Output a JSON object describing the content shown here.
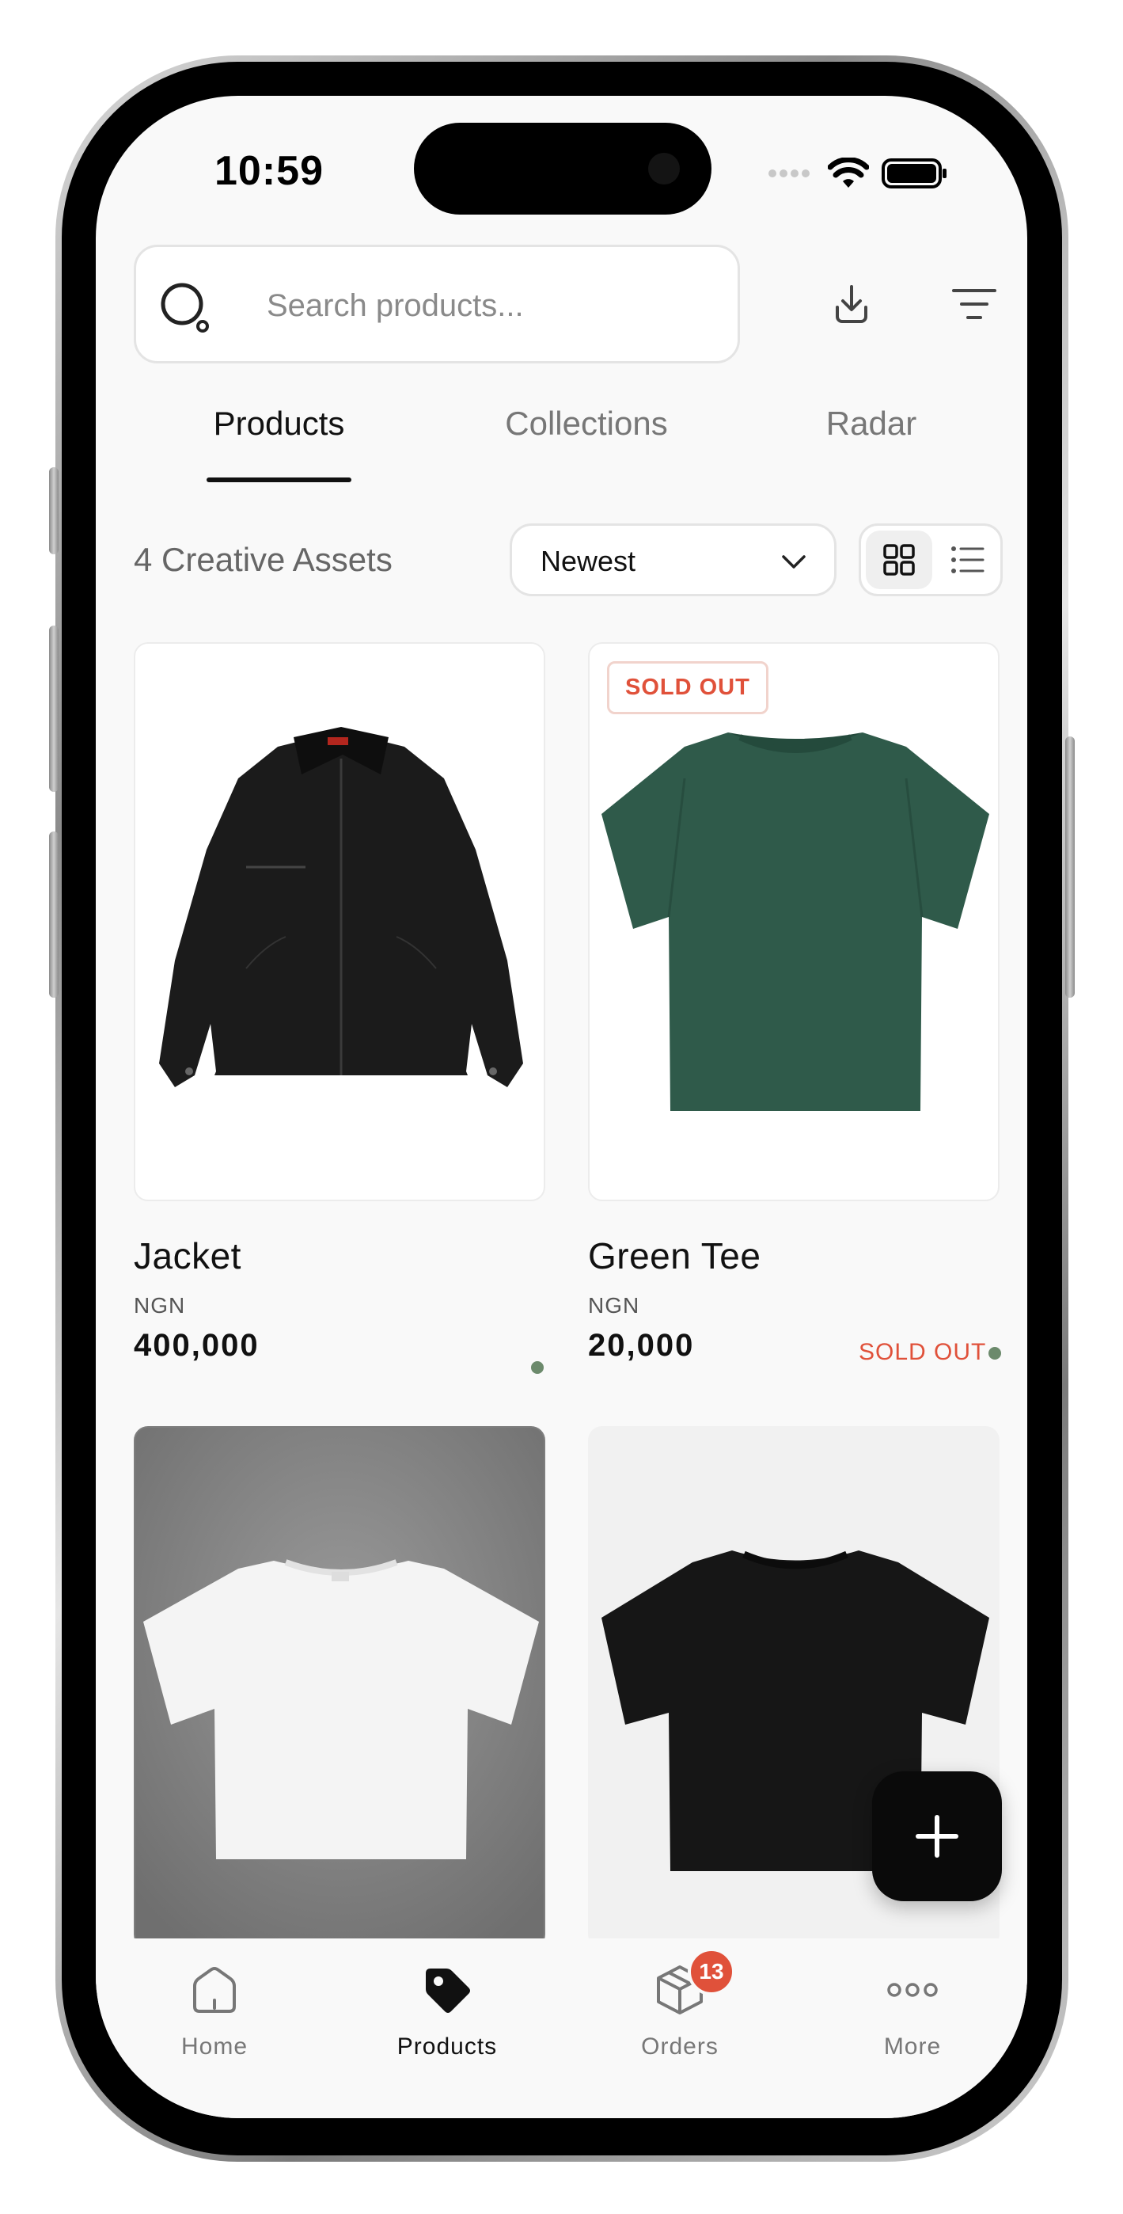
{
  "status_bar": {
    "time": "10:59"
  },
  "search": {
    "placeholder": "Search products..."
  },
  "tabs": [
    {
      "label": "Products",
      "active": true
    },
    {
      "label": "Collections",
      "active": false
    },
    {
      "label": "Radar",
      "active": false
    }
  ],
  "filter": {
    "asset_count": "4 Creative Assets",
    "sort_value": "Newest",
    "view_mode": "grid"
  },
  "products": [
    {
      "name": "Jacket",
      "currency": "NGN",
      "price": "400,000",
      "sold_out": false,
      "image": "black-jacket",
      "status_dot_color": "#6c8a6c"
    },
    {
      "name": "Green Tee",
      "currency": "NGN",
      "price": "20,000",
      "sold_out": true,
      "badge": "SOLD OUT",
      "status_label": "SOLD OUT",
      "image": "green-tee",
      "status_dot_color": "#6c8a6c"
    },
    {
      "image": "white-tee"
    },
    {
      "image": "black-tee"
    }
  ],
  "fab": {
    "icon": "plus-icon"
  },
  "nav": [
    {
      "label": "Home",
      "icon": "home-icon",
      "active": false
    },
    {
      "label": "Products",
      "icon": "tag-icon",
      "active": true
    },
    {
      "label": "Orders",
      "icon": "box-icon",
      "active": false,
      "badge": "13"
    },
    {
      "label": "More",
      "icon": "more-icon",
      "active": false
    }
  ],
  "colors": {
    "accent": "#e0513a",
    "dot": "#6c8a6c",
    "background": "#f9f9f9"
  }
}
